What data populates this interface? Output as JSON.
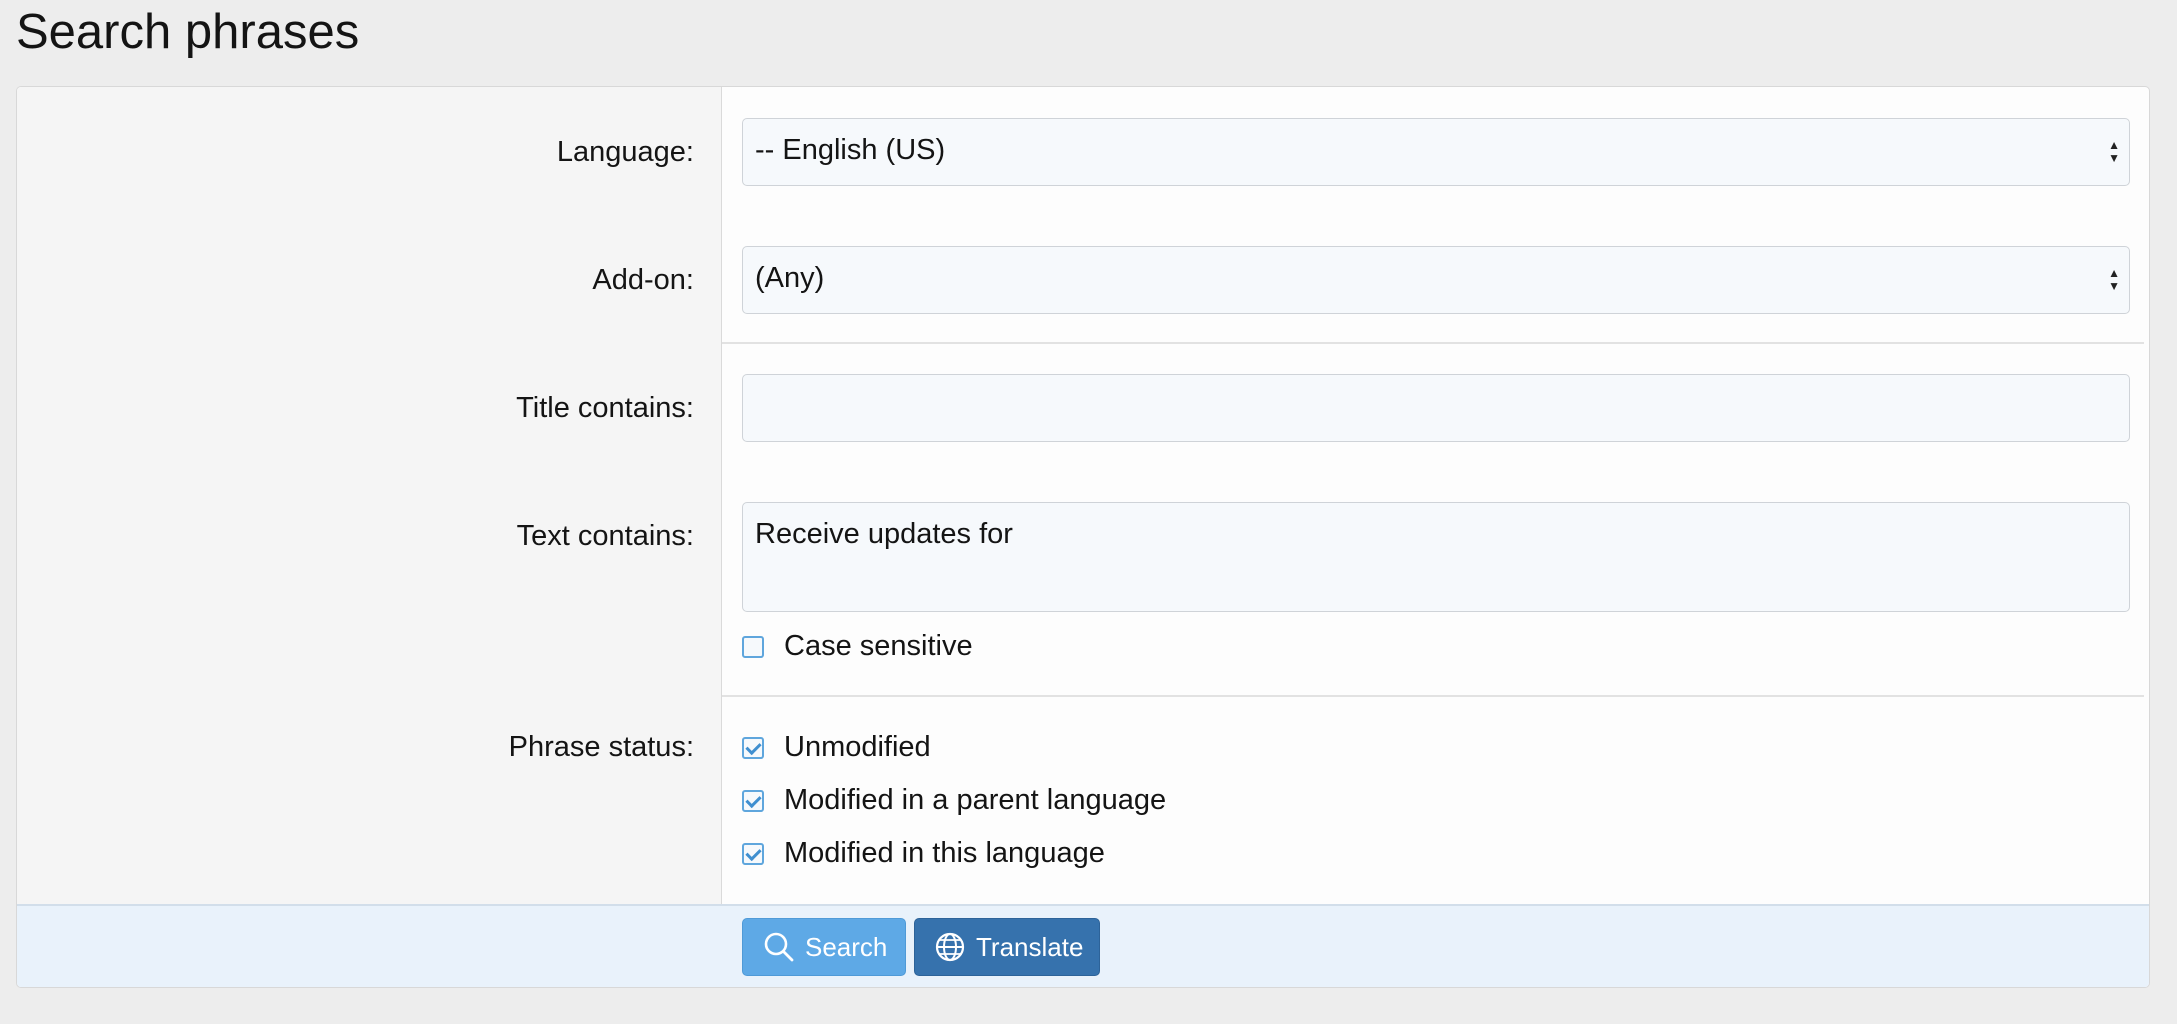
{
  "page_title": "Search phrases",
  "form": {
    "language": {
      "label": "Language:",
      "value": "-- English (US)"
    },
    "addon": {
      "label": "Add-on:",
      "value": "(Any)"
    },
    "title_contains": {
      "label": "Title contains:",
      "value": ""
    },
    "text_contains": {
      "label": "Text contains:",
      "value": "Receive updates for"
    },
    "case_sensitive": {
      "label": "Case sensitive",
      "checked": false
    },
    "phrase_status": {
      "label": "Phrase status:",
      "options": [
        {
          "label": "Unmodified",
          "checked": true
        },
        {
          "label": "Modified in a parent language",
          "checked": true
        },
        {
          "label": "Modified in this language",
          "checked": true
        }
      ]
    }
  },
  "buttons": {
    "search": {
      "label": "Search",
      "icon": "search-icon"
    },
    "translate": {
      "label": "Translate",
      "icon": "globe-icon"
    }
  },
  "colors": {
    "search_button": "#5ea9e6",
    "translate_button": "#3672ad",
    "checkbox_accent": "#5fa6dd"
  }
}
